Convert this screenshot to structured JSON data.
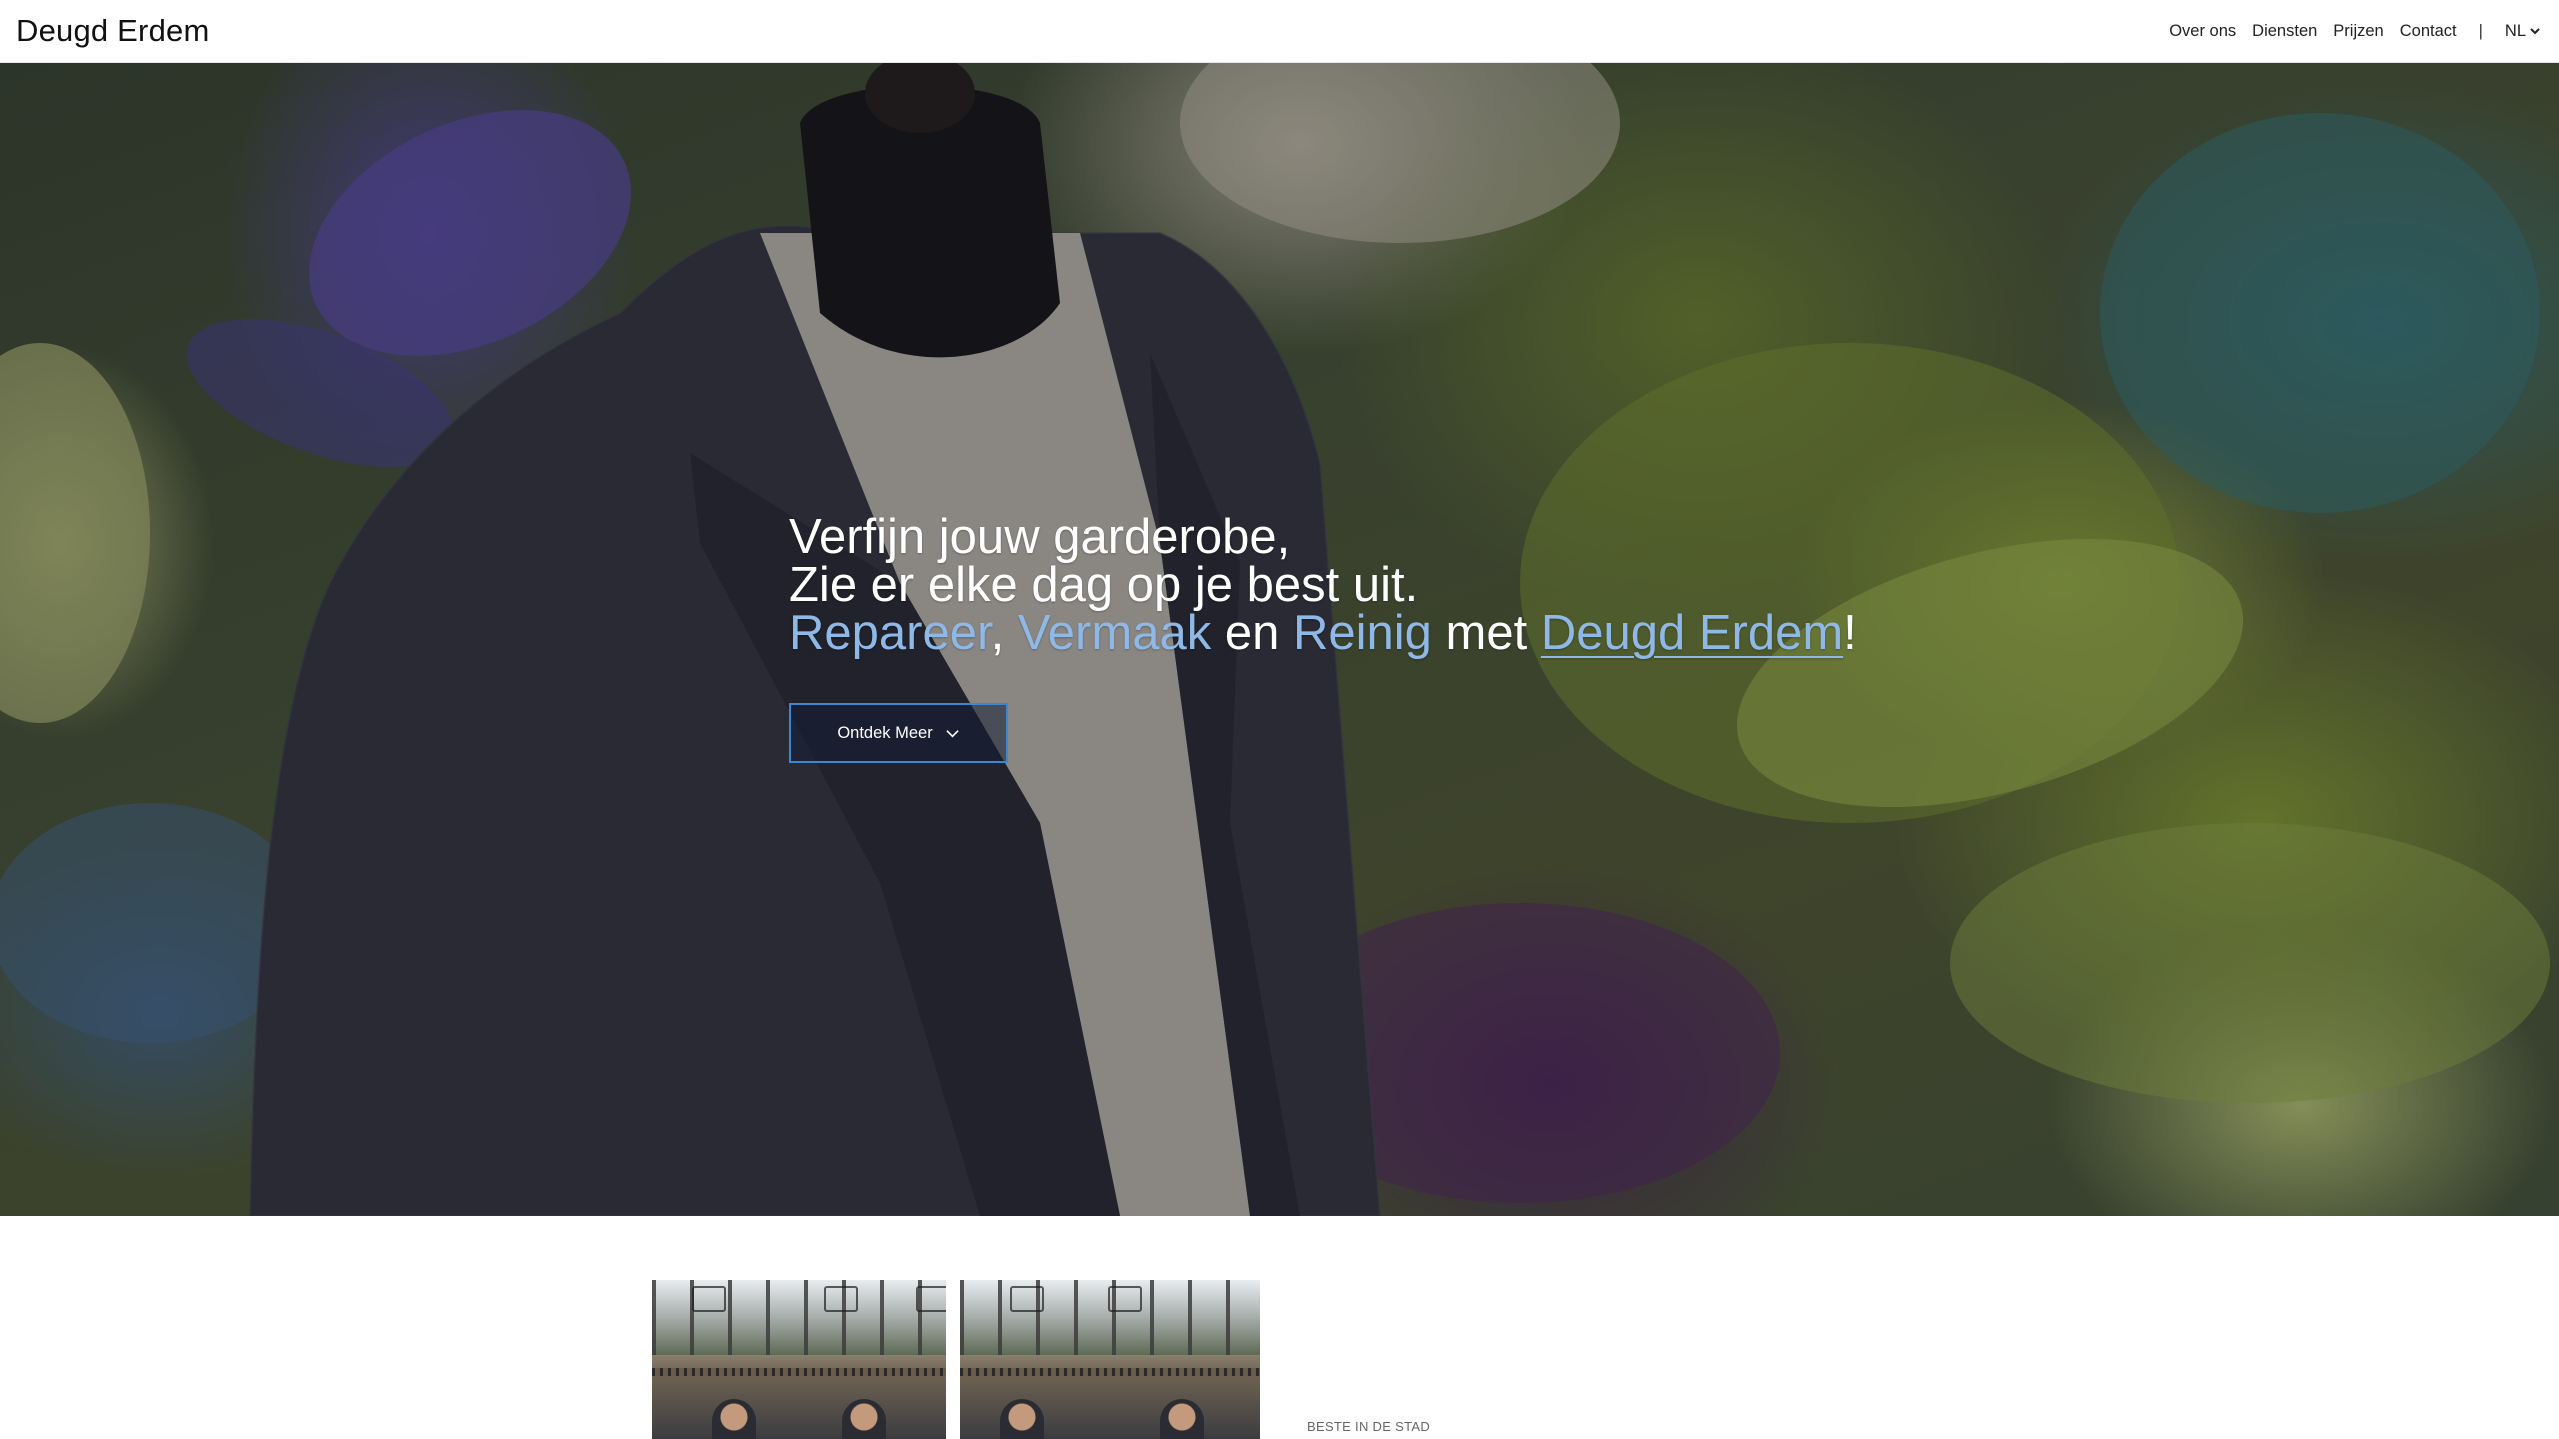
{
  "header": {
    "brand": "Deugd Erdem",
    "nav": [
      "Over ons",
      "Diensten",
      "Prijzen",
      "Contact"
    ],
    "separator": "|",
    "language": "NL",
    "language_icon": "chevron-down-icon"
  },
  "hero": {
    "line1": "Verfijn jouw garderobe,",
    "line2": "Zie er elke dag op je best uit.",
    "line3": {
      "word1": "Repareer",
      "comma": ",",
      "word2": "Vermaak",
      "en": "en",
      "word3": "Reinig",
      "met": "met",
      "brand_link": "Deugd Erdem",
      "exclamation": "!"
    },
    "accent_color": "#8fb8e6",
    "cta_label": "Ontdek Meer",
    "cta_icon": "chevron-down-icon",
    "cta_border_color": "#3d86d0"
  },
  "intro": {
    "kicker": "BESTE IN DE STAD"
  }
}
